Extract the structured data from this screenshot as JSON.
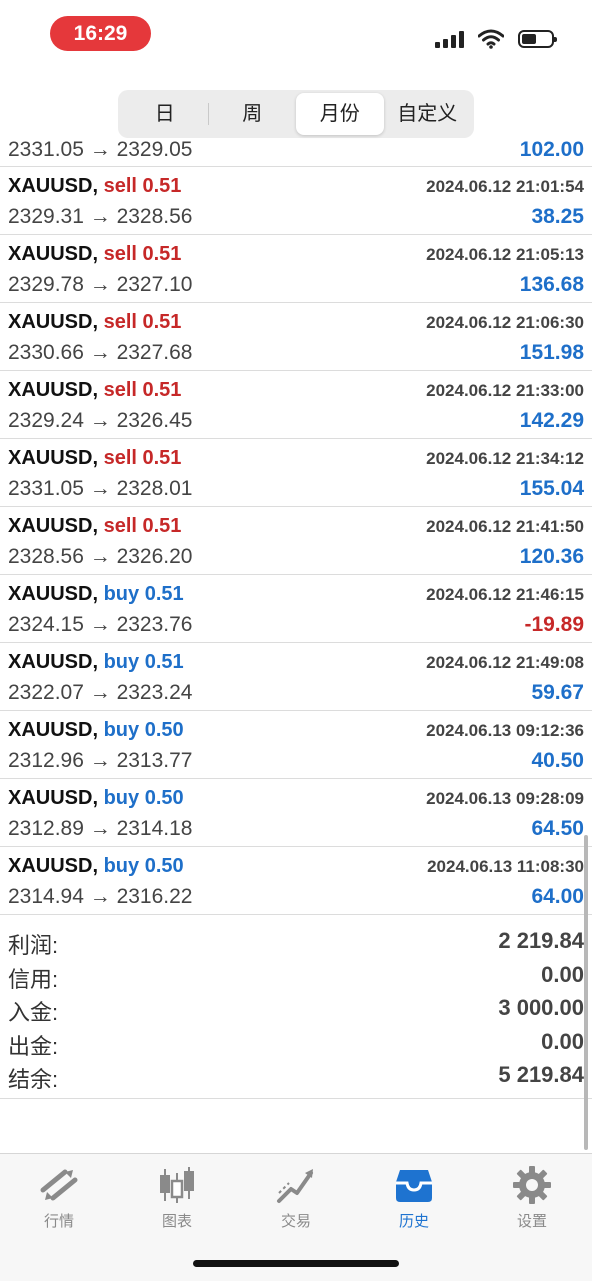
{
  "status_bar": {
    "time": "16:29",
    "icons": [
      "cellular-signal-icon",
      "wifi-icon",
      "battery-icon"
    ]
  },
  "period_tabs": [
    {
      "label": "日",
      "active": false
    },
    {
      "label": "周",
      "active": false
    },
    {
      "label": "月份",
      "active": true
    },
    {
      "label": "自定义",
      "active": false
    }
  ],
  "partial_row": {
    "prices": "2331.05 → 2329.05",
    "profit": "102.00"
  },
  "deals": [
    {
      "symbol": "XAUUSD,",
      "side": "sell 0.51",
      "datetime": "2024.06.12 21:01:54",
      "prices": "2329.31 → 2328.56",
      "profit": "38.25"
    },
    {
      "symbol": "XAUUSD,",
      "side": "sell 0.51",
      "datetime": "2024.06.12 21:05:13",
      "prices": "2329.78 → 2327.10",
      "profit": "136.68"
    },
    {
      "symbol": "XAUUSD,",
      "side": "sell 0.51",
      "datetime": "2024.06.12 21:06:30",
      "prices": "2330.66 → 2327.68",
      "profit": "151.98"
    },
    {
      "symbol": "XAUUSD,",
      "side": "sell 0.51",
      "datetime": "2024.06.12 21:33:00",
      "prices": "2329.24 → 2326.45",
      "profit": "142.29"
    },
    {
      "symbol": "XAUUSD,",
      "side": "sell 0.51",
      "datetime": "2024.06.12 21:34:12",
      "prices": "2331.05 → 2328.01",
      "profit": "155.04"
    },
    {
      "symbol": "XAUUSD,",
      "side": "sell 0.51",
      "datetime": "2024.06.12 21:41:50",
      "prices": "2328.56 → 2326.20",
      "profit": "120.36"
    },
    {
      "symbol": "XAUUSD,",
      "side": "buy 0.51",
      "datetime": "2024.06.12 21:46:15",
      "prices": "2324.15 → 2323.76",
      "profit": "-19.89"
    },
    {
      "symbol": "XAUUSD,",
      "side": "buy 0.51",
      "datetime": "2024.06.12 21:49:08",
      "prices": "2322.07 → 2323.24",
      "profit": "59.67"
    },
    {
      "symbol": "XAUUSD,",
      "side": "buy 0.50",
      "datetime": "2024.06.13 09:12:36",
      "prices": "2312.96 → 2313.77",
      "profit": "40.50"
    },
    {
      "symbol": "XAUUSD,",
      "side": "buy 0.50",
      "datetime": "2024.06.13 09:28:09",
      "prices": "2312.89 → 2314.18",
      "profit": "64.50"
    },
    {
      "symbol": "XAUUSD,",
      "side": "buy 0.50",
      "datetime": "2024.06.13 11:08:30",
      "prices": "2314.94 → 2316.22",
      "profit": "64.00"
    }
  ],
  "summary": [
    {
      "label": "利润:",
      "value": "2 219.84"
    },
    {
      "label": "信用:",
      "value": "0.00"
    },
    {
      "label": "入金:",
      "value": "3 000.00"
    },
    {
      "label": "出金:",
      "value": "0.00"
    },
    {
      "label": "结余:",
      "value": "5 219.84"
    }
  ],
  "colors": {
    "sell": "#c62828",
    "buy": "#1e6fc9",
    "negative": "#c62828",
    "active_tab": "#1e73d0",
    "time_pill": "#e5383b"
  },
  "tab_bar": [
    {
      "label": "行情",
      "icon": "quotes-icon",
      "active": false
    },
    {
      "label": "图表",
      "icon": "candlestick-chart-icon",
      "active": false
    },
    {
      "label": "交易",
      "icon": "trade-icon",
      "active": false
    },
    {
      "label": "历史",
      "icon": "history-inbox-icon",
      "active": true
    },
    {
      "label": "设置",
      "icon": "gear-icon",
      "active": false
    }
  ]
}
